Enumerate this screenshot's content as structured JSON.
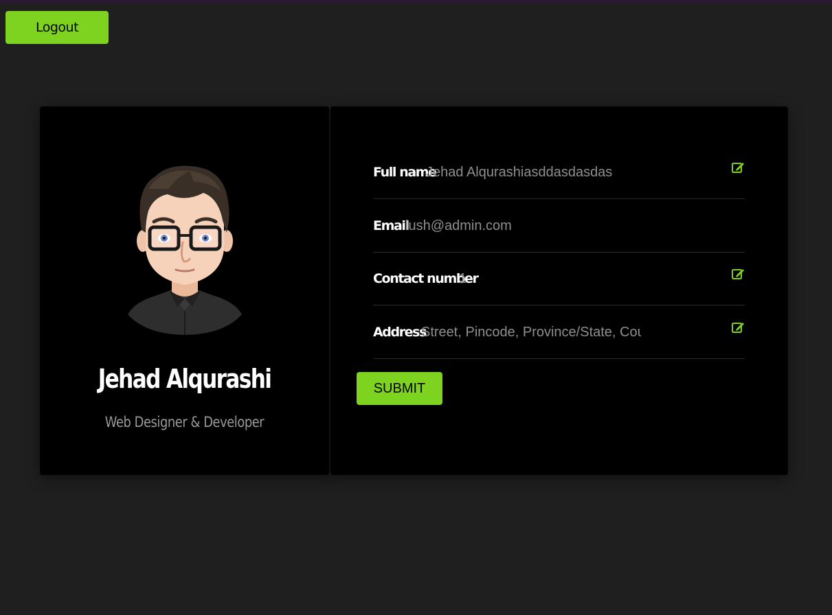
{
  "header": {
    "logout_label": "Logout"
  },
  "profile": {
    "name": "Jehad Alqurashi",
    "role": "Web Designer & Developer"
  },
  "form": {
    "fields": [
      {
        "label": "Full name",
        "value": "Jehad Alqurashiasddasdasdas",
        "placeholder": "",
        "editable": true
      },
      {
        "label": "Email",
        "value": "lush@admin.com",
        "placeholder": "",
        "editable": false
      },
      {
        "label": "Contact number",
        "value": "1",
        "placeholder": "",
        "editable": true
      },
      {
        "label": "Address",
        "value": "",
        "placeholder": "Street, Pincode, Province/State, Country",
        "editable": true
      }
    ],
    "submit_label": "SUBMIT"
  },
  "icons": {
    "edit": "edit-icon"
  },
  "colors": {
    "accent": "#7ed321",
    "background": "#1f1f1f",
    "card": "#000000",
    "muted_text": "#8f8f8f"
  }
}
